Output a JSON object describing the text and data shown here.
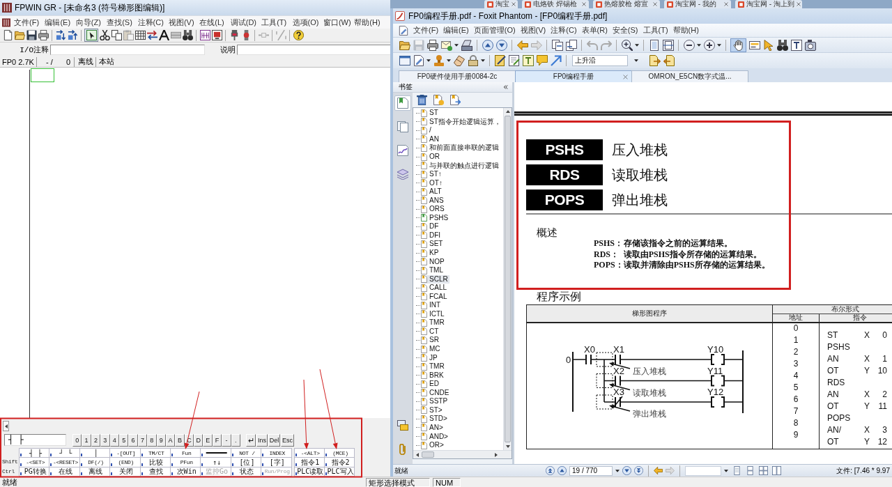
{
  "background_tabs": [
    {
      "label": "淘宝"
    },
    {
      "label": "电烙铁 焊锡枪"
    },
    {
      "label": "热熔胶枪 熔宣"
    },
    {
      "label": "淘宝网 - 我的"
    },
    {
      "label": "淘宝网 - 淘上到"
    }
  ],
  "fpwin": {
    "title": "FPWIN GR - [未命名3 (符号梯形图编辑)]",
    "menu": [
      "文件(F)",
      "编辑(E)",
      "向导(Z)",
      "查找(S)",
      "注释(C)",
      "视图(V)",
      "在线(L)",
      "调试(D)",
      "工具(T)",
      "选项(O)",
      "窗口(W)",
      "帮助(H)"
    ],
    "select_mode": {
      "selected": true
    },
    "io_comment": {
      "label": "I/O注释"
    },
    "description": {
      "label": "说明"
    },
    "info_bar": [
      [
        "FP0 2.7K"
      ],
      [
        "- /",
        "0"
      ],
      [
        "离线"
      ],
      [
        "本站"
      ]
    ],
    "keypad": {
      "entry_value": "┤ ├",
      "keys": [
        "0",
        "1",
        "2",
        "3",
        "4",
        "5",
        "6",
        "7",
        "8",
        "9",
        "A",
        "B",
        "C",
        "D",
        "E",
        "F",
        "-",
        "."
      ],
      "edit_keys": [
        "↵",
        "Ins",
        "Del",
        "Esc"
      ]
    },
    "function_keys": [
      {
        "keys": [
          {
            "kind": "text",
            "label": "┤ ├",
            "disabled": false
          },
          {
            "kind": "text",
            "label": "┘ └",
            "disabled": false
          },
          {
            "kind": "text",
            "label": "│",
            "disabled": false
          },
          {
            "kind": "text",
            "label": "-[OUT]",
            "disabled": false
          },
          {
            "kind": "text",
            "label": "TM/CT",
            "disabled": false
          },
          {
            "kind": "text",
            "label": "Fun",
            "disabled": false
          },
          {
            "kind": "line",
            "disabled": false
          },
          {
            "kind": "text",
            "label": "NOT /",
            "disabled": false
          },
          {
            "kind": "text",
            "label": "INDEX",
            "disabled": false
          },
          {
            "kind": "text",
            "label": "-<ALT>",
            "disabled": false
          },
          {
            "kind": "text",
            "label": "(MCE)",
            "disabled": false
          }
        ]
      },
      {
        "modifier": "Shift",
        "keys": [
          {
            "kind": "text",
            "label": "-<SET>",
            "disabled": false
          },
          {
            "kind": "text",
            "label": "-<RESET>",
            "disabled": false
          },
          {
            "kind": "text",
            "label": "DF(/)",
            "disabled": false
          },
          {
            "kind": "text",
            "label": "(END)",
            "disabled": false
          },
          {
            "kind": "text",
            "label": "比较",
            "disabled": false
          },
          {
            "kind": "text",
            "label": "PFun",
            "disabled": false
          },
          {
            "kind": "text",
            "label": "↑↓",
            "disabled": false
          },
          {
            "kind": "text",
            "label": "[位]",
            "disabled": false
          },
          {
            "kind": "text",
            "label": "[字]",
            "disabled": false
          },
          {
            "kind": "text",
            "label": "指令1",
            "disabled": false
          },
          {
            "kind": "text",
            "label": "指令2",
            "disabled": false
          }
        ]
      },
      {
        "modifier": "Ctrl",
        "keys": [
          {
            "kind": "text",
            "label": "PG转换",
            "disabled": false
          },
          {
            "kind": "text",
            "label": "在线",
            "disabled": false
          },
          {
            "kind": "text",
            "label": "离线",
            "disabled": false
          },
          {
            "kind": "text",
            "label": "关闭",
            "disabled": false
          },
          {
            "kind": "text",
            "label": "查找",
            "disabled": false
          },
          {
            "kind": "text",
            "label": "次Win",
            "disabled": false
          },
          {
            "kind": "text",
            "label": "监控Go",
            "disabled": true
          },
          {
            "kind": "text",
            "label": "状态",
            "disabled": false
          },
          {
            "kind": "text",
            "label": "Run/Prog",
            "disabled": true
          },
          {
            "kind": "text",
            "label": "PLC读取",
            "disabled": false
          },
          {
            "kind": "text",
            "label": "PLC写入",
            "disabled": false
          }
        ]
      }
    ],
    "status_bar": [
      "就绪",
      "矩形选择模式",
      "NUM"
    ]
  },
  "foxit": {
    "title": "FP0编程手册.pdf - Foxit Phantom - [FP0编程手册.pdf]",
    "menu": [
      "文件(F)",
      "编辑(E)",
      "页面管理(O)",
      "视图(V)",
      "注释(C)",
      "表单(R)",
      "安全(S)",
      "工具(T)",
      "帮助(H)"
    ],
    "hand_tool": {
      "selected": true
    },
    "style_combo": {
      "value": "上升沿"
    },
    "tabs": [
      {
        "label": "FP0硬件使用手册0084-2c",
        "selected": false
      },
      {
        "label": "FP0编程手册",
        "selected": true
      },
      {
        "label": "OMRON_E5CN数字式温...",
        "selected": false
      }
    ],
    "side_panels": {
      "top": [
        {
          "kind": "bookmarks",
          "selected": true
        },
        {
          "kind": "pages",
          "selected": false
        },
        {
          "kind": "signatures",
          "selected": false
        },
        {
          "kind": "layers",
          "selected": false
        }
      ],
      "bottom": [
        {
          "kind": "comments",
          "selected": false
        },
        {
          "kind": "attachments",
          "selected": false
        }
      ]
    },
    "bookmarks": {
      "title": "书签",
      "items": [
        {
          "label": "ST",
          "current": false,
          "highlighted": false
        },
        {
          "label": "ST指令开始逻辑运算，",
          "current": false,
          "highlighted": false
        },
        {
          "label": "/",
          "current": false,
          "highlighted": false
        },
        {
          "label": "AN",
          "current": false,
          "highlighted": false
        },
        {
          "label": "和前面直接串联的逻辑",
          "current": false,
          "highlighted": false
        },
        {
          "label": "OR",
          "current": false,
          "highlighted": false
        },
        {
          "label": "与并联的触点进行逻辑",
          "current": false,
          "highlighted": false
        },
        {
          "label": "ST↑",
          "current": false,
          "highlighted": false
        },
        {
          "label": "OT↑",
          "current": false,
          "highlighted": false
        },
        {
          "label": "ALT",
          "current": false,
          "highlighted": false
        },
        {
          "label": "ANS",
          "current": false,
          "highlighted": false
        },
        {
          "label": "ORS",
          "current": false,
          "highlighted": false
        },
        {
          "label": "PSHS",
          "current": true,
          "highlighted": false
        },
        {
          "label": "DF",
          "current": false,
          "highlighted": false
        },
        {
          "label": "DFI",
          "current": false,
          "highlighted": false
        },
        {
          "label": "SET",
          "current": false,
          "highlighted": false
        },
        {
          "label": "KP",
          "current": false,
          "highlighted": false
        },
        {
          "label": "NOP",
          "current": false,
          "highlighted": false
        },
        {
          "label": "TML",
          "current": false,
          "highlighted": false
        },
        {
          "label": "SCLR",
          "current": false,
          "highlighted": true
        },
        {
          "label": "CALL",
          "current": false,
          "highlighted": false
        },
        {
          "label": "FCAL",
          "current": false,
          "highlighted": false
        },
        {
          "label": "INT",
          "current": false,
          "highlighted": false
        },
        {
          "label": "ICTL",
          "current": false,
          "highlighted": false
        },
        {
          "label": "TMR",
          "current": false,
          "highlighted": false
        },
        {
          "label": "CT",
          "current": false,
          "highlighted": false
        },
        {
          "label": "SR",
          "current": false,
          "highlighted": false
        },
        {
          "label": "MC",
          "current": false,
          "highlighted": false
        },
        {
          "label": "JP",
          "current": false,
          "highlighted": false
        },
        {
          "label": "TMR",
          "current": false,
          "highlighted": false
        },
        {
          "label": "BRK",
          "current": false,
          "highlighted": false
        },
        {
          "label": "ED",
          "current": false,
          "highlighted": false
        },
        {
          "label": "CNDE",
          "current": false,
          "highlighted": false
        },
        {
          "label": "SSTP",
          "current": false,
          "highlighted": false
        },
        {
          "label": "ST>",
          "current": false,
          "highlighted": false
        },
        {
          "label": "STD>",
          "current": false,
          "highlighted": false
        },
        {
          "label": "AN>",
          "current": false,
          "highlighted": false
        },
        {
          "label": "AND>",
          "current": false,
          "highlighted": false
        },
        {
          "label": "OR>",
          "current": false,
          "highlighted": false
        }
      ]
    },
    "document": {
      "instructions": [
        {
          "mnemonic": "PSHS",
          "name": "压入堆栈"
        },
        {
          "mnemonic": "RDS",
          "name": "读取堆栈"
        },
        {
          "mnemonic": "POPS",
          "name": "弹出堆栈"
        }
      ],
      "overview": {
        "heading": "概述",
        "lines": [
          {
            "term": "PSHS：",
            "text": "存储该指令之前的运算结果。"
          },
          {
            "term": "RDS：",
            "text": "读取由PSHS指令所存储的运算结果。"
          },
          {
            "term": "POPS：",
            "text": "读取并清除由PSHS所存储的运算结果。"
          }
        ]
      },
      "example": {
        "heading": "程序示例",
        "ladder_header": "梯形图程序",
        "boolean_header": "布尔形式",
        "address_header": "地址",
        "instruction_header": "指令",
        "ladder": {
          "rung_number": "0",
          "input": "X0",
          "branches": [
            {
              "contact": "X1",
              "normally_closed": false,
              "coil": "Y10",
              "note": "压入堆栈"
            },
            {
              "contact": "X2",
              "normally_closed": false,
              "coil": "Y11",
              "note": "读取堆栈"
            },
            {
              "contact": "X3",
              "normally_closed": true,
              "coil": "Y12",
              "note": "弹出堆栈"
            }
          ]
        },
        "addresses": [
          "0",
          "1",
          "2",
          "3",
          "4",
          "5",
          "6",
          "7",
          "8",
          "9"
        ],
        "instructions": [
          {
            "op": "ST",
            "device": "X",
            "number": "0"
          },
          {
            "op": "PSHS"
          },
          {
            "op": "AN",
            "device": "X",
            "number": "1"
          },
          {
            "op": "OT",
            "device": "Y",
            "number": "10"
          },
          {
            "op": "RDS"
          },
          {
            "op": "AN",
            "device": "X",
            "number": "2"
          },
          {
            "op": "OT",
            "device": "Y",
            "number": "11"
          },
          {
            "op": "POPS"
          },
          {
            "op": "AN/",
            "device": "X",
            "number": "3"
          },
          {
            "op": "OT",
            "device": "Y",
            "number": "12"
          }
        ]
      }
    },
    "status_bar": {
      "text": "就绪",
      "page": "19 / 770",
      "page_size": "文件: [7.46 * 9.97"
    }
  }
}
